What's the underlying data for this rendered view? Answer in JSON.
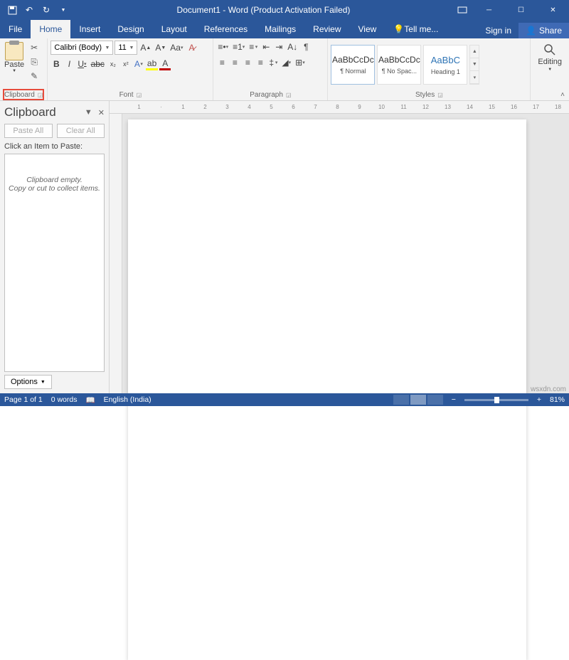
{
  "title": "Document1 - Word (Product Activation Failed)",
  "tabs": {
    "file": "File",
    "home": "Home",
    "insert": "Insert",
    "design": "Design",
    "layout": "Layout",
    "references": "References",
    "mailings": "Mailings",
    "review": "Review",
    "view": "View",
    "tellme": "Tell me...",
    "signin": "Sign in",
    "share": "Share"
  },
  "ribbon": {
    "clipboard": {
      "label": "Clipboard",
      "paste": "Paste"
    },
    "font": {
      "label": "Font",
      "name": "Calibri (Body)",
      "size": "11"
    },
    "paragraph": {
      "label": "Paragraph"
    },
    "styles": {
      "label": "Styles",
      "normal_sample": "AaBbCcDc",
      "normal": "¶ Normal",
      "nospace_sample": "AaBbCcDc",
      "nospace": "¶ No Spac...",
      "heading_sample": "AaBbC",
      "heading": "Heading 1"
    },
    "editing": {
      "label": "Editing"
    }
  },
  "pane": {
    "title": "Clipboard",
    "paste_all": "Paste All",
    "clear_all": "Clear All",
    "hint": "Click an Item to Paste:",
    "empty1": "Clipboard empty.",
    "empty2": "Copy or cut to collect items.",
    "options": "Options"
  },
  "status": {
    "page": "Page 1 of 1",
    "words": "0 words",
    "lang": "English (India)",
    "zoom": "81%"
  },
  "watermark": "wsxdn.com"
}
